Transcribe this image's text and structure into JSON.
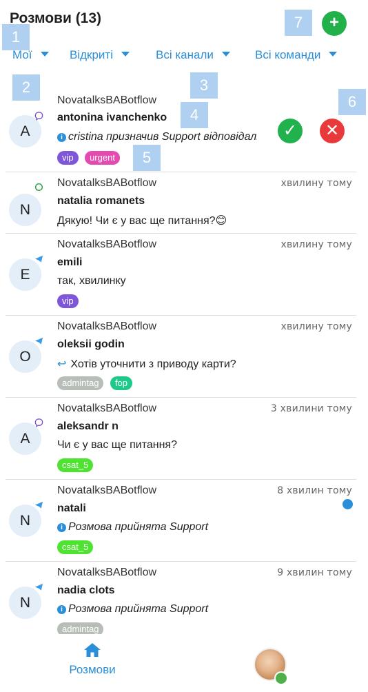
{
  "header": {
    "title": "Розмови (13)",
    "add_button": "+"
  },
  "filters": {
    "mine": "Мої",
    "status": "Відкриті",
    "channels": "Всі канали",
    "teams": "Всі команди"
  },
  "markers": [
    "1",
    "2",
    "3",
    "4",
    "5",
    "6",
    "7"
  ],
  "conversations": [
    {
      "avatar": "A",
      "channel": "viber-icon",
      "inbox": "NovatalksBABotflow",
      "name": "antonina ivanchenko",
      "message_prefix": "cristina",
      "message": " призначив ",
      "message_suffix": "Support відповідальн",
      "message_style": "info-italic",
      "tags": [
        {
          "label": "vip",
          "color": "#7f56d9"
        },
        {
          "label": "urgent",
          "color": "#e34bb0"
        }
      ],
      "accept": "✓",
      "reject": "✕",
      "time": ""
    },
    {
      "avatar": "N",
      "channel": "whatsapp-icon",
      "inbox": "NovatalksBABotflow",
      "name": "natalia romanets",
      "message": "Дякую! Чи є у вас ще питання?😊",
      "message_style": "plain",
      "tags": [],
      "time": "хвилину тому"
    },
    {
      "avatar": "E",
      "channel": "telegram-icon",
      "inbox": "NovatalksBABotflow",
      "name": "emili",
      "message": "так, хвилинку",
      "message_style": "plain",
      "tags": [
        {
          "label": "vip",
          "color": "#7f56d9"
        }
      ],
      "time": "хвилину тому"
    },
    {
      "avatar": "O",
      "channel": "telegram-icon",
      "inbox": "NovatalksBABotflow",
      "name": "oleksii godin",
      "message": "Хотів уточнити з приводу карти?",
      "message_style": "reply",
      "tags": [
        {
          "label": "admintag",
          "color": "#b7beb8"
        },
        {
          "label": "fop",
          "color": "#1fc98a"
        }
      ],
      "time": "хвилину тому"
    },
    {
      "avatar": "A",
      "channel": "viber-icon",
      "inbox": "NovatalksBABotflow",
      "name": "aleksandr n",
      "message": "Чи є у вас ще питання?",
      "message_style": "plain",
      "tags": [
        {
          "label": "csat_5",
          "color": "#4fe331"
        }
      ],
      "time": "3 хвилини тому"
    },
    {
      "avatar": "N",
      "channel": "telegram-icon",
      "inbox": "NovatalksBABotflow",
      "name": "natali",
      "message": "Розмова прийнята Support",
      "message_style": "info-italic",
      "tags": [
        {
          "label": "csat_5",
          "color": "#4fe331"
        }
      ],
      "time": "8 хвилин тому",
      "unread": true
    },
    {
      "avatar": "N",
      "channel": "telegram-icon",
      "inbox": "NovatalksBABotflow",
      "name": "nadia clots",
      "message": "Розмова прийнята Support",
      "message_style": "info-italic",
      "tags": [
        {
          "label": "admintag",
          "color": "#b7beb8"
        }
      ],
      "time": "9 хвилин тому"
    }
  ],
  "bottom_nav": {
    "conversations_label": "Розмови"
  },
  "colors": {
    "accent": "#2a8fd8",
    "accept": "#21b14d",
    "reject": "#e83a3a"
  }
}
